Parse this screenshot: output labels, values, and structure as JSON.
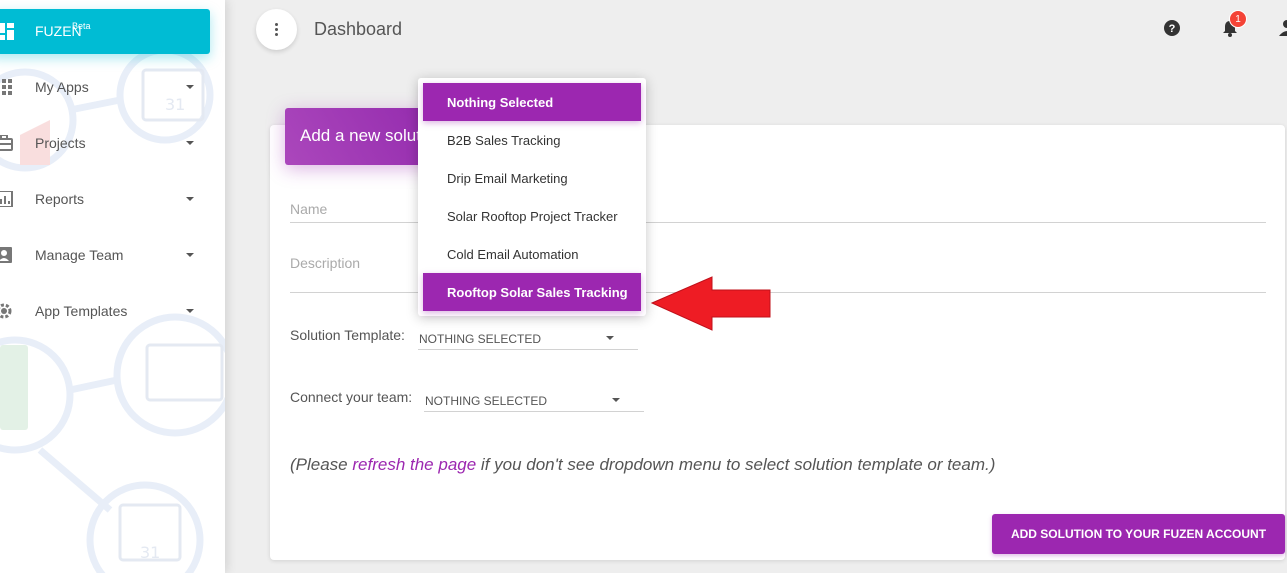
{
  "sidebar": {
    "brand": {
      "name": "FUZEN",
      "badge": "Beta"
    },
    "items": [
      {
        "label": "My Apps",
        "icon": "grid-icon"
      },
      {
        "label": "Projects",
        "icon": "briefcase-icon"
      },
      {
        "label": "Reports",
        "icon": "bar-chart-icon"
      },
      {
        "label": "Manage Team",
        "icon": "contact-card-icon"
      },
      {
        "label": "App Templates",
        "icon": "gear-icon"
      }
    ]
  },
  "topbar": {
    "title": "Dashboard",
    "notification_count": "1"
  },
  "card": {
    "header": "Add a new solution",
    "name_placeholder": "Name",
    "description_placeholder": "Description",
    "template_label": "Solution Template:",
    "template_value": "NOTHING SELECTED",
    "team_label": "Connect your team:",
    "team_value": "NOTHING SELECTED",
    "note_prefix": "(Please ",
    "note_link": "refresh the page",
    "note_suffix": " if you don't see dropdown menu to select solution template or team.)",
    "submit_label": "ADD SOLUTION TO YOUR FUZEN ACCOUNT"
  },
  "dropdown": {
    "options": [
      {
        "label": "Nothing Selected",
        "active": true
      },
      {
        "label": "B2B Sales Tracking",
        "active": false
      },
      {
        "label": "Drip Email Marketing",
        "active": false
      },
      {
        "label": "Solar Rooftop Project Tracker",
        "active": false
      },
      {
        "label": "Cold Email Automation",
        "active": false
      },
      {
        "label": "Rooftop Solar Sales Tracking",
        "active": true
      }
    ]
  },
  "colors": {
    "brand": "#00bcd4",
    "accent": "#9c27b0",
    "badge": "#f44336",
    "annotation_arrow": "#ee1c24"
  }
}
